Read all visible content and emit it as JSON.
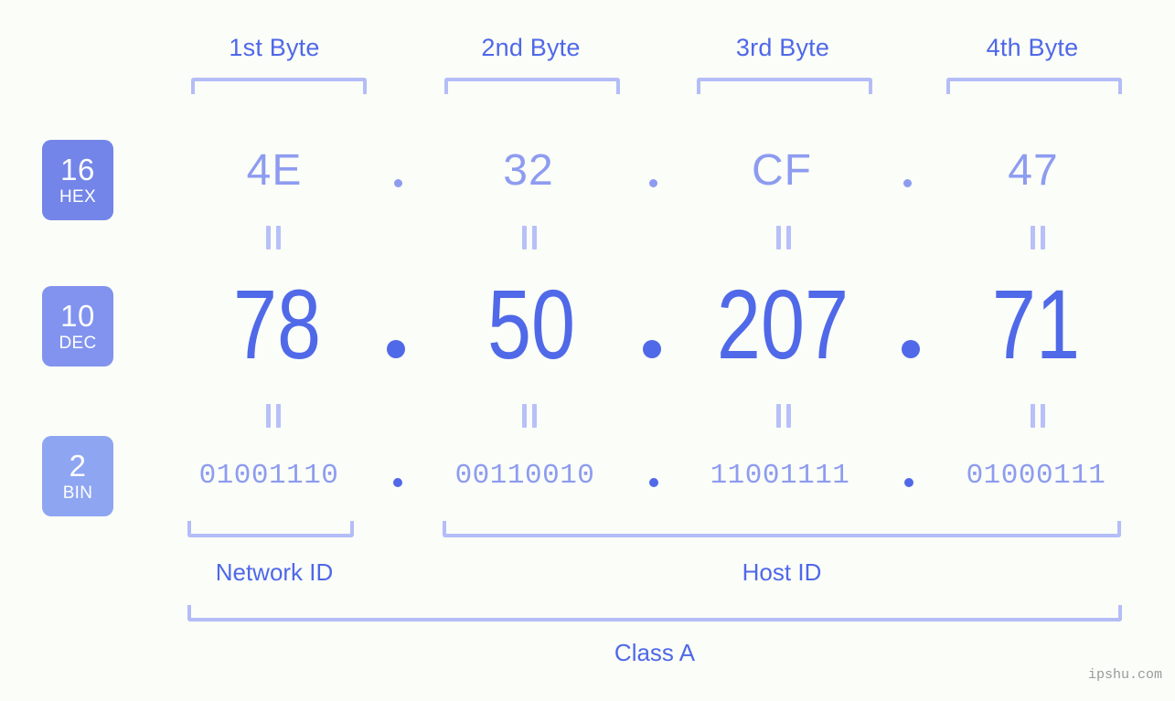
{
  "page": {
    "background_color": "#fbfdf8",
    "accent_color": "#5069e8",
    "accent_light_color": "#8d9cf0",
    "bracket_color": "#b4bdf7",
    "watermark": "ipshu.com"
  },
  "headers": [
    {
      "label": "1st Byte"
    },
    {
      "label": "2nd Byte"
    },
    {
      "label": "3rd Byte"
    },
    {
      "label": "4th Byte"
    }
  ],
  "bases": [
    {
      "num": "16",
      "name": "HEX",
      "color": "#7385e8"
    },
    {
      "num": "10",
      "name": "DEC",
      "color": "#8193ee"
    },
    {
      "num": "2",
      "name": "BIN",
      "color": "#8ea5f2"
    }
  ],
  "rows": {
    "hex": {
      "values": [
        "4E",
        "32",
        "CF",
        "47"
      ],
      "separator": "."
    },
    "dec": {
      "values": [
        "78",
        "50",
        "207",
        "71"
      ],
      "separator": "."
    },
    "bin": {
      "values": [
        "01001110",
        "00110010",
        "11001111",
        "01000111"
      ],
      "separator": "."
    }
  },
  "equals_symbol": "=",
  "segments": {
    "network_id": {
      "label": "Network ID",
      "bytes": [
        1
      ]
    },
    "host_id": {
      "label": "Host ID",
      "bytes": [
        2,
        3,
        4
      ]
    }
  },
  "class": {
    "label": "Class A"
  }
}
